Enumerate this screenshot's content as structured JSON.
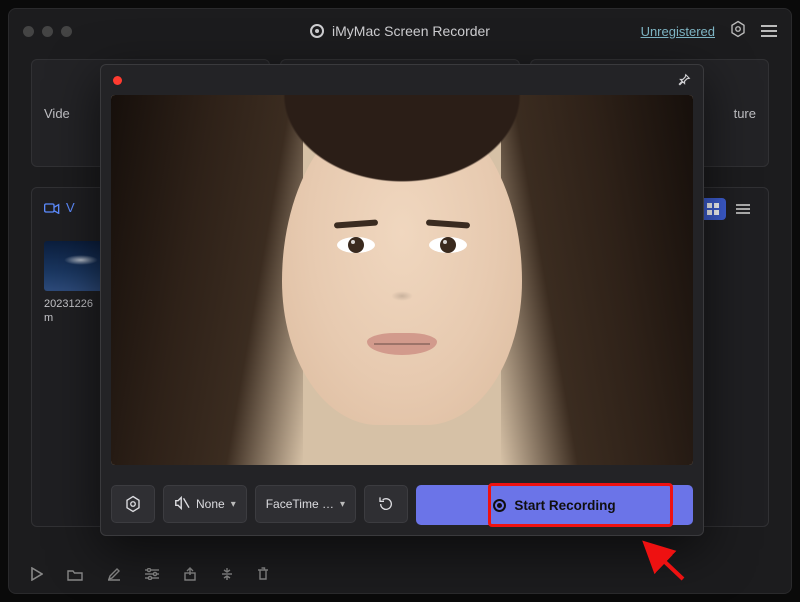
{
  "app": {
    "title": "iMyMac Screen Recorder"
  },
  "header": {
    "unregistered": "Unregistered"
  },
  "tabs": {
    "video_label_partial": "Vide",
    "capture_label_partial": "ture"
  },
  "library": {
    "header_partial": "V",
    "file": {
      "name_line1": "20231226",
      "name_line2": "m"
    }
  },
  "dialog": {
    "audio_label": "None",
    "camera_label": "FaceTime …",
    "start_label": "Start Recording"
  }
}
